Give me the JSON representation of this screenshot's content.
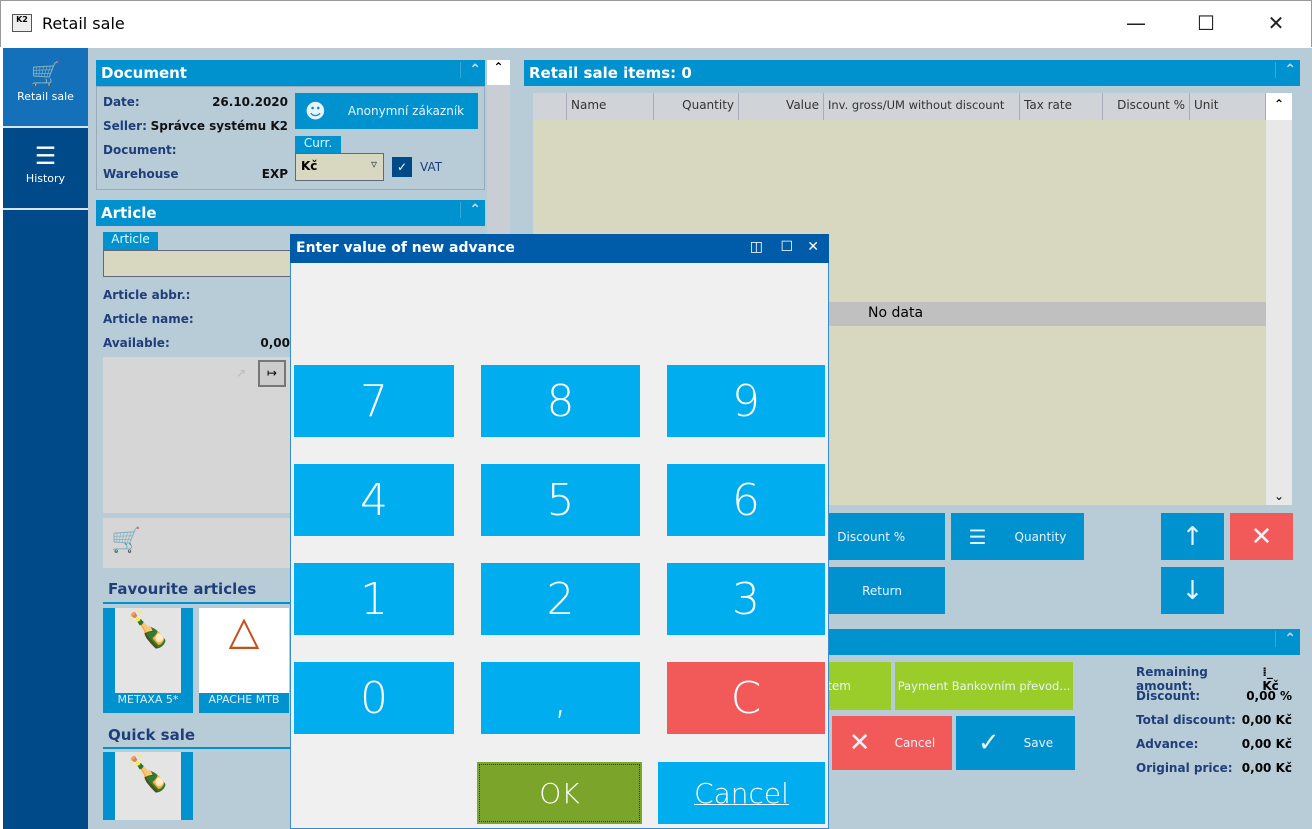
{
  "window": {
    "title": "Retail sale",
    "icon": "k2-app-icon",
    "controls": [
      "minimize",
      "maximize",
      "close"
    ]
  },
  "nav": [
    {
      "label": "Retail sale",
      "icon": "cart-icon",
      "selected": true
    },
    {
      "label": "History",
      "icon": "menu-icon"
    }
  ],
  "document": {
    "header": "Document",
    "date_label": "Date:",
    "date": "26.10.2020",
    "seller_label": "Seller:",
    "seller": "Správce systému K2",
    "document_label": "Document:",
    "warehouse_label": "Warehouse",
    "warehouse": "EXP",
    "customer_button": "Anonymní zákazník",
    "curr_label": "Curr.",
    "currency": "Kč",
    "vat_label": "VAT",
    "vat_checked": true
  },
  "article": {
    "header": "Article",
    "field_label": "Article",
    "abbr_label": "Article abbr.:",
    "name_label": "Article name:",
    "available_label": "Available:",
    "available": "0,00"
  },
  "favourites": {
    "header": "Favourite articles",
    "items": [
      "METAXA 5*",
      "APACHE MTB"
    ]
  },
  "quick_sale": {
    "header": "Quick sale"
  },
  "items": {
    "header": "Retail sale items: 0",
    "columns": [
      "Name",
      "Quantity",
      "Value",
      "Inv. gross/UM without discount",
      "Tax rate",
      "Discount %",
      "Unit"
    ],
    "empty_text": "No data"
  },
  "actions": {
    "discount": "Discount %",
    "quantity": "Quantity",
    "return": "Return"
  },
  "payment": {
    "partial_button": "tem",
    "bank_button": "Payment Bankovním převod...",
    "cancel": "Cancel",
    "save": "Save"
  },
  "summary": [
    {
      "label": "Remaining amount:",
      "value": "⁞_ Kč"
    },
    {
      "label": "Discount:",
      "value": "0,00 %"
    },
    {
      "label": "Total discount:",
      "value": "0,00 Kč"
    },
    {
      "label": "Advance:",
      "value": "0,00 Kč"
    },
    {
      "label": "Original price:",
      "value": "0,00 Kč"
    }
  ],
  "dialog": {
    "title": "Enter value of new advance",
    "value": "",
    "keys": [
      "7",
      "8",
      "9",
      "4",
      "5",
      "6",
      "1",
      "2",
      "3",
      "0",
      ",",
      "C"
    ],
    "ok": "OK",
    "cancel": "Cancel"
  },
  "colors": {
    "accent": "#0091cf",
    "nav": "#004a8a",
    "key": "#00adef",
    "danger": "#f25a5a",
    "ok": "#7aa52a",
    "green": "#9acd2a"
  }
}
